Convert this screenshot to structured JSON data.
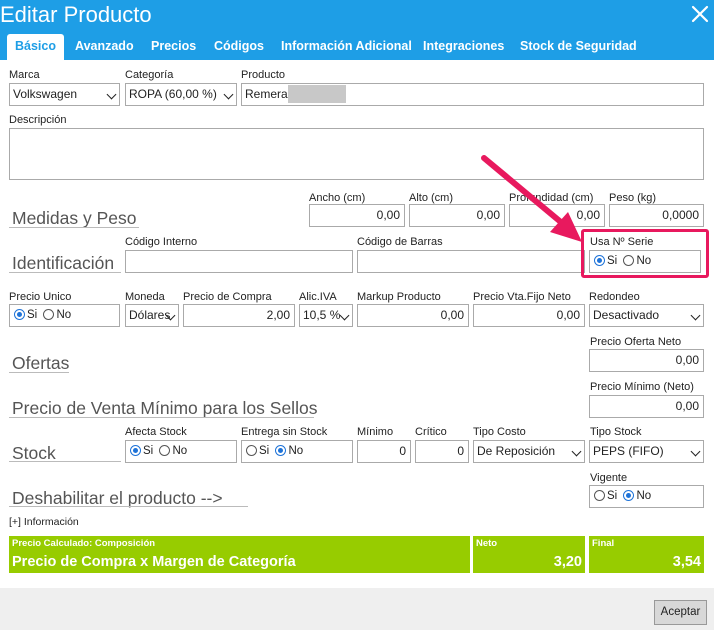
{
  "window": {
    "title": "Editar Producto"
  },
  "tabs": [
    "Básico",
    "Avanzado",
    "Precios",
    "Códigos",
    "Información Adicional",
    "Integraciones",
    "Stock de Seguridad"
  ],
  "fields": {
    "marca": {
      "label": "Marca",
      "value": "Volkswagen"
    },
    "categoria": {
      "label": "Categoría",
      "value": "ROPA (60,00 %)"
    },
    "producto": {
      "label": "Producto",
      "value": "Remera"
    },
    "descripcion": {
      "label": "Descripción",
      "value": ""
    }
  },
  "medidas": {
    "section": "Medidas y Peso",
    "ancho": {
      "label": "Ancho (cm)",
      "value": "0,00"
    },
    "alto": {
      "label": "Alto (cm)",
      "value": "0,00"
    },
    "profundidad": {
      "label": "Profundidad (cm)",
      "value": "0,00"
    },
    "peso": {
      "label": "Peso (kg)",
      "value": "0,0000"
    }
  },
  "identificacion": {
    "section": "Identificación",
    "codigo_interno": {
      "label": "Código Interno",
      "value": ""
    },
    "codigo_barras": {
      "label": "Código de Barras",
      "value": ""
    },
    "usa_serie": {
      "label": "Usa Nº Serie",
      "options": [
        "Si",
        "No"
      ],
      "selected": "Si"
    }
  },
  "precios": {
    "precio_unico": {
      "label": "Precio Unico",
      "options": [
        "Si",
        "No"
      ],
      "selected": "Si"
    },
    "moneda": {
      "label": "Moneda",
      "value": "Dólares"
    },
    "precio_compra": {
      "label": "Precio de Compra",
      "value": "2,00"
    },
    "alic_iva": {
      "label": "Alic.IVA",
      "value": "10,5 %"
    },
    "markup": {
      "label": "Markup Producto",
      "value": "0,00"
    },
    "precio_vta_fijo": {
      "label": "Precio Vta.Fijo Neto",
      "value": "0,00"
    },
    "redondeo": {
      "label": "Redondeo",
      "value": "Desactivado"
    }
  },
  "ofertas": {
    "section": "Ofertas",
    "label": "Precio Oferta Neto",
    "value": "0,00"
  },
  "precio_minimo": {
    "section": "Precio de Venta Mínimo para los Sellos",
    "label": "Precio Mínimo (Neto)",
    "value": "0,00"
  },
  "stock": {
    "section": "Stock",
    "afecta": {
      "label": "Afecta Stock",
      "options": [
        "Si",
        "No"
      ],
      "selected": "Si"
    },
    "entrega": {
      "label": "Entrega sin Stock",
      "options": [
        "Si",
        "No"
      ],
      "selected": "No"
    },
    "minimo": {
      "label": "Mínimo",
      "value": "0"
    },
    "critico": {
      "label": "Crítico",
      "value": "0"
    },
    "tipo_costo": {
      "label": "Tipo Costo",
      "value": "De Reposición"
    },
    "tipo_stock": {
      "label": "Tipo Stock",
      "value": "PEPS (FIFO)"
    }
  },
  "deshabilitar": {
    "section": "Deshabilitar el producto -->",
    "label": "Vigente",
    "options": [
      "Si",
      "No"
    ],
    "selected": "No"
  },
  "info_link": "[+] Información",
  "calculo": {
    "title": "Precio Calculado: Composición",
    "formula": "Precio de Compra x Margen de Categoría",
    "neto_label": "Neto",
    "neto_value": "3,20",
    "final_label": "Final",
    "final_value": "3,54"
  },
  "footer": {
    "accept": "Aceptar"
  },
  "colors": {
    "header": "#1e9ee6",
    "green": "#97cc00",
    "highlight": "#e8195e"
  }
}
